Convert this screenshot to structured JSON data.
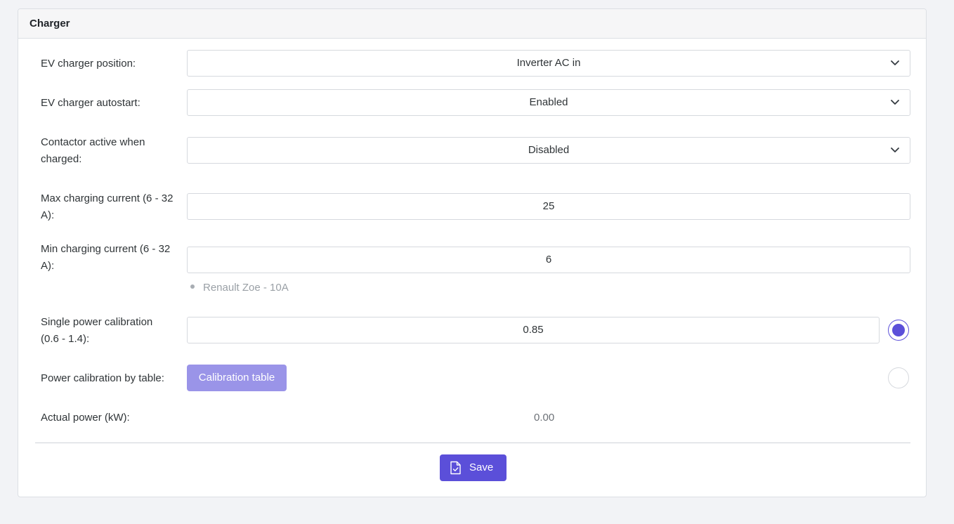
{
  "panel": {
    "title": "Charger"
  },
  "fields": {
    "ev_charger_position": {
      "label": "EV charger position:",
      "value": "Inverter AC in"
    },
    "ev_charger_autostart": {
      "label": "EV charger autostart:",
      "value": "Enabled"
    },
    "contactor_active": {
      "label": "Contactor active when charged:",
      "value": "Disabled"
    },
    "max_current": {
      "label": "Max charging current (6 - 32 A):",
      "value": "25"
    },
    "min_current": {
      "label": "Min charging current (6 - 32 A):",
      "value": "6",
      "hint": "Renault Zoe - 10A"
    },
    "single_calibration": {
      "label": "Single power calibration (0.6 - 1.4):",
      "value": "0.85",
      "selected": true
    },
    "table_calibration": {
      "label": "Power calibration by table:",
      "button_label": "Calibration table",
      "selected": false
    },
    "actual_power": {
      "label": "Actual power (kW):",
      "value": "0.00"
    }
  },
  "actions": {
    "save_label": "Save"
  },
  "icons": {
    "select_arrow": "chevron-down-icon",
    "save": "file-check-icon"
  },
  "colors": {
    "accent": "#5b4fd9",
    "accent_light": "#9a94e8",
    "page_bg": "#f2f3f6"
  }
}
